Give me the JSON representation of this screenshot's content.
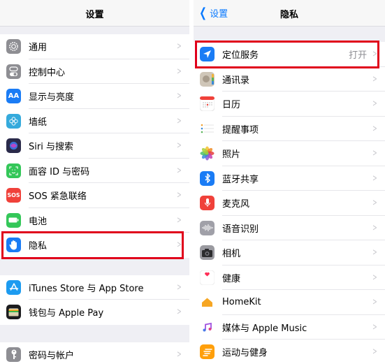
{
  "left": {
    "title": "设置",
    "groups": [
      [
        {
          "label": "通用",
          "icon": "gear-icon",
          "color": "#8e8e93"
        },
        {
          "label": "控制中心",
          "icon": "toggles-icon",
          "color": "#8e8e93"
        },
        {
          "label": "显示与亮度",
          "icon": "text-size-icon",
          "color": "#1a7cf5",
          "glyph": "AA"
        },
        {
          "label": "墙纸",
          "icon": "flower-icon",
          "color": "#35aadc"
        },
        {
          "label": "Siri 与搜索",
          "icon": "siri-icon",
          "color": "#2a2a4a"
        },
        {
          "label": "面容 ID 与密码",
          "icon": "face-id-icon",
          "color": "#34c759"
        },
        {
          "label": "SOS 紧急联络",
          "icon": "sos-icon",
          "color": "#f0413a",
          "glyph": "SOS"
        },
        {
          "label": "电池",
          "icon": "battery-icon",
          "color": "#34c759"
        },
        {
          "label": "隐私",
          "icon": "hand-icon",
          "color": "#1a7cf5",
          "highlighted": true
        }
      ],
      [
        {
          "label": "iTunes Store 与 App Store",
          "icon": "app-store-icon",
          "color": "#1d9bf0"
        },
        {
          "label": "钱包与 Apple Pay",
          "icon": "wallet-icon",
          "color": "#1c1c1e"
        }
      ],
      [
        {
          "label": "密码与帐户",
          "icon": "key-icon",
          "color": "#8e8e93"
        }
      ]
    ]
  },
  "right": {
    "back_label": "设置",
    "title": "隐私",
    "items": [
      {
        "label": "定位服务",
        "value": "打开",
        "icon": "location-arrow-icon",
        "color": "#1a7cf5",
        "highlighted": true
      },
      {
        "label": "通讯录",
        "icon": "contacts-icon",
        "color": "#b5ab9e"
      },
      {
        "label": "日历",
        "icon": "calendar-icon",
        "color": "#ffffff"
      },
      {
        "label": "提醒事项",
        "icon": "reminders-icon",
        "color": "#ffffff"
      },
      {
        "label": "照片",
        "icon": "photos-icon",
        "color": "#ffffff"
      },
      {
        "label": "蓝牙共享",
        "icon": "bluetooth-icon",
        "color": "#1a7cf5"
      },
      {
        "label": "麦克风",
        "icon": "microphone-icon",
        "color": "#f0413a"
      },
      {
        "label": "语音识别",
        "icon": "waveform-icon",
        "color": "#a0a0a8"
      },
      {
        "label": "相机",
        "icon": "camera-icon",
        "color": "#8e8e93"
      },
      {
        "label": "健康",
        "icon": "heart-icon",
        "color": "#ffffff"
      },
      {
        "label": "HomeKit",
        "icon": "home-icon",
        "color": "#ffffff"
      },
      {
        "label": "媒体与 Apple Music",
        "icon": "music-note-icon",
        "color": "#ffffff"
      },
      {
        "label": "运动与健身",
        "icon": "fitness-icon",
        "color": "#ff9f0a"
      }
    ]
  },
  "chevron_glyph": ">",
  "highlight_color": "#e0001b"
}
